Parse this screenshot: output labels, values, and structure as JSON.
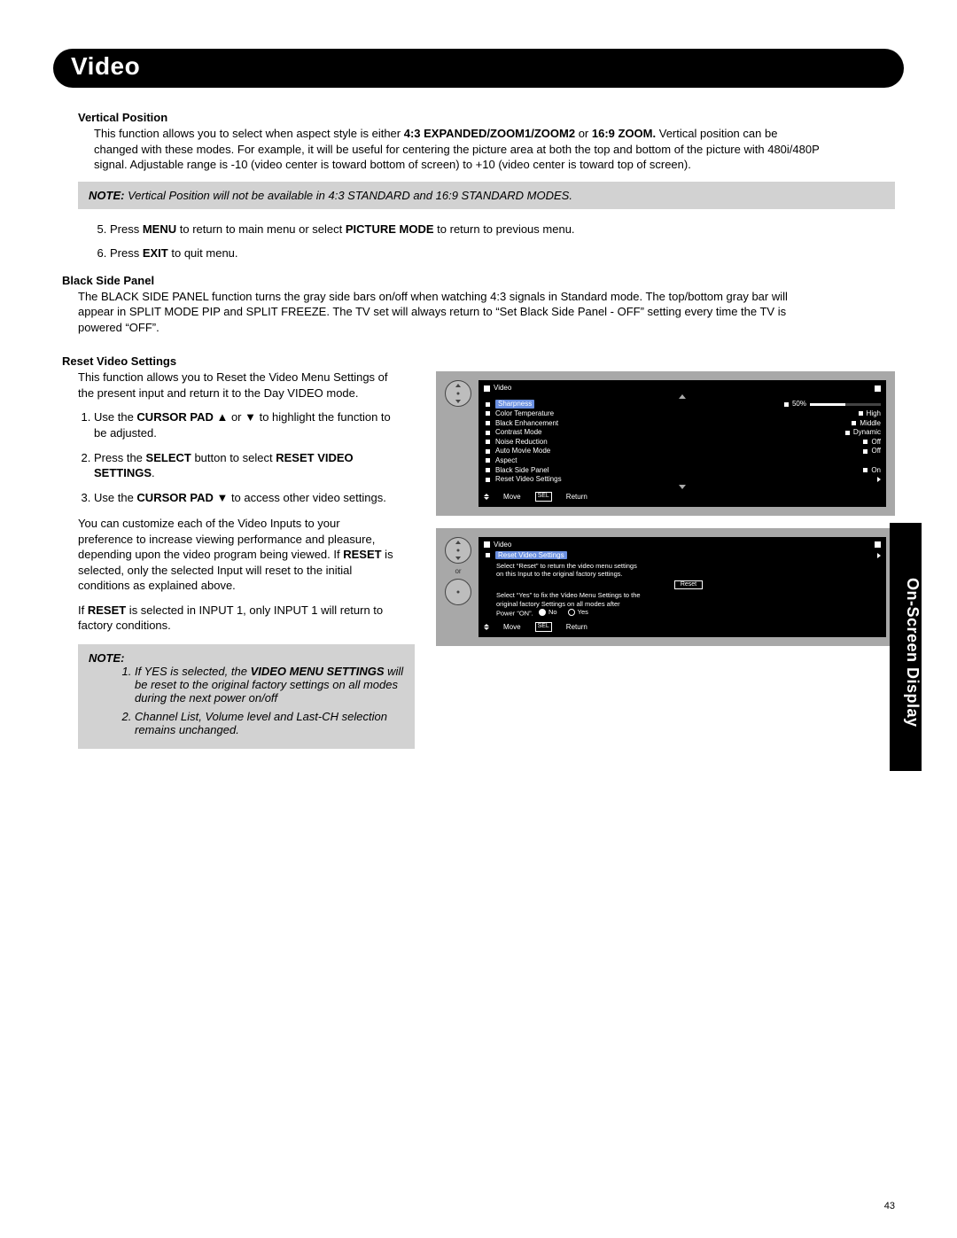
{
  "header": {
    "title": "Video"
  },
  "section_tab": "On-Screen Display",
  "page_number": "43",
  "vertical_position": {
    "heading": "Vertical Position",
    "body_prefix": "This function allows you to select when aspect style is either ",
    "bold1": "4:3 EXPANDED/ZOOM1/ZOOM2",
    "mid1": " or ",
    "bold2": "16:9 ZOOM.",
    "body_suffix": " Vertical position can be changed with these modes. For example, it will be useful for centering the picture area at both the top and bottom of the picture with 480i/480P signal. Adjustable range is -10 (video center is toward bottom of screen) to +10 (video center is toward top of screen)."
  },
  "note1": {
    "label": "NOTE:",
    "text": " Vertical Position will not be available in 4:3 STANDARD and 16:9 STANDARD MODES."
  },
  "steps_a": {
    "s5_pre": "Press ",
    "s5_b1": "MENU",
    "s5_mid": " to return to main menu or select ",
    "s5_b2": "PICTURE MODE",
    "s5_post": " to return to previous menu.",
    "s6_pre": "Press ",
    "s6_b1": "EXIT",
    "s6_post": " to quit menu."
  },
  "black_side_panel": {
    "heading": "Black Side Panel",
    "body": "The BLACK SIDE PANEL function turns the gray side bars on/off when watching 4:3 signals in Standard mode. The top/bottom gray bar will appear in SPLIT MODE PIP and SPLIT FREEZE. The TV set will always return to “Set Black Side Panel - OFF” setting every time the TV is powered “OFF”."
  },
  "reset_video": {
    "heading": "Reset Video Settings",
    "intro": "This function allows you to Reset the Video Menu Settings of the present input and return it to the Day VIDEO mode.",
    "s1_pre": "Use the ",
    "s1_b": "CURSOR PAD",
    "s1_post": " ▲ or ▼ to highlight the function to be adjusted.",
    "s2_pre": "Press the ",
    "s2_b1": "SELECT",
    "s2_mid": " button to select ",
    "s2_b2": "RESET VIDEO SETTINGS",
    "s2_post": ".",
    "s3_pre": "Use the ",
    "s3_b": "CURSOR PAD",
    "s3_post": " ▼ to access other video settings.",
    "para2_pre": "You can customize each of the Video Inputs to your preference to increase viewing performance and pleasure, depending upon the video program being viewed. If ",
    "para2_b": "RESET",
    "para2_post": " is selected, only the selected Input will reset to the initial conditions as explained above.",
    "para3_pre": "If ",
    "para3_b": "RESET",
    "para3_post": " is selected in INPUT 1, only INPUT 1 will return to factory conditions."
  },
  "note2": {
    "label": "NOTE:",
    "i1_pre": "If YES is selected, the ",
    "i1_b": "VIDEO MENU SETTINGS",
    "i1_post": " will be reset to the original factory settings on all modes during the next power on/off",
    "i2": "Channel List, Volume level and Last-CH selection remains unchanged."
  },
  "osd1": {
    "title": "Video",
    "rows": [
      {
        "label": "Sharpness",
        "val": "50%",
        "bar": true
      },
      {
        "label": "Color Temperature",
        "val": "High"
      },
      {
        "label": "Black Enhancement",
        "val": "Middle"
      },
      {
        "label": "Contrast Mode",
        "val": "Dynamic"
      },
      {
        "label": "Noise Reduction",
        "val": "Off"
      },
      {
        "label": "Auto Movie Mode",
        "val": "Off"
      },
      {
        "label": "Aspect",
        "val": ""
      },
      {
        "label": "Black Side Panel",
        "val": "On"
      },
      {
        "label": "Reset Video Settings",
        "val": "",
        "tri": true
      }
    ],
    "footer_move": "Move",
    "footer_sel": "SEL",
    "footer_return": "Return"
  },
  "osd2": {
    "title": "Video",
    "row_label": "Reset Video Settings",
    "line1": "Select “Reset” to return the video menu settings",
    "line2": "on this Input to the original factory settings.",
    "reset_btn": "Reset",
    "line3": "Select “Yes” to fix the Video Menu Settings to the",
    "line4": "original factory Settings on all modes after",
    "line5": "Power “ON”.",
    "no": "No",
    "yes": "Yes",
    "footer_move": "Move",
    "footer_sel": "SEL",
    "footer_return": "Return",
    "or": "or"
  }
}
